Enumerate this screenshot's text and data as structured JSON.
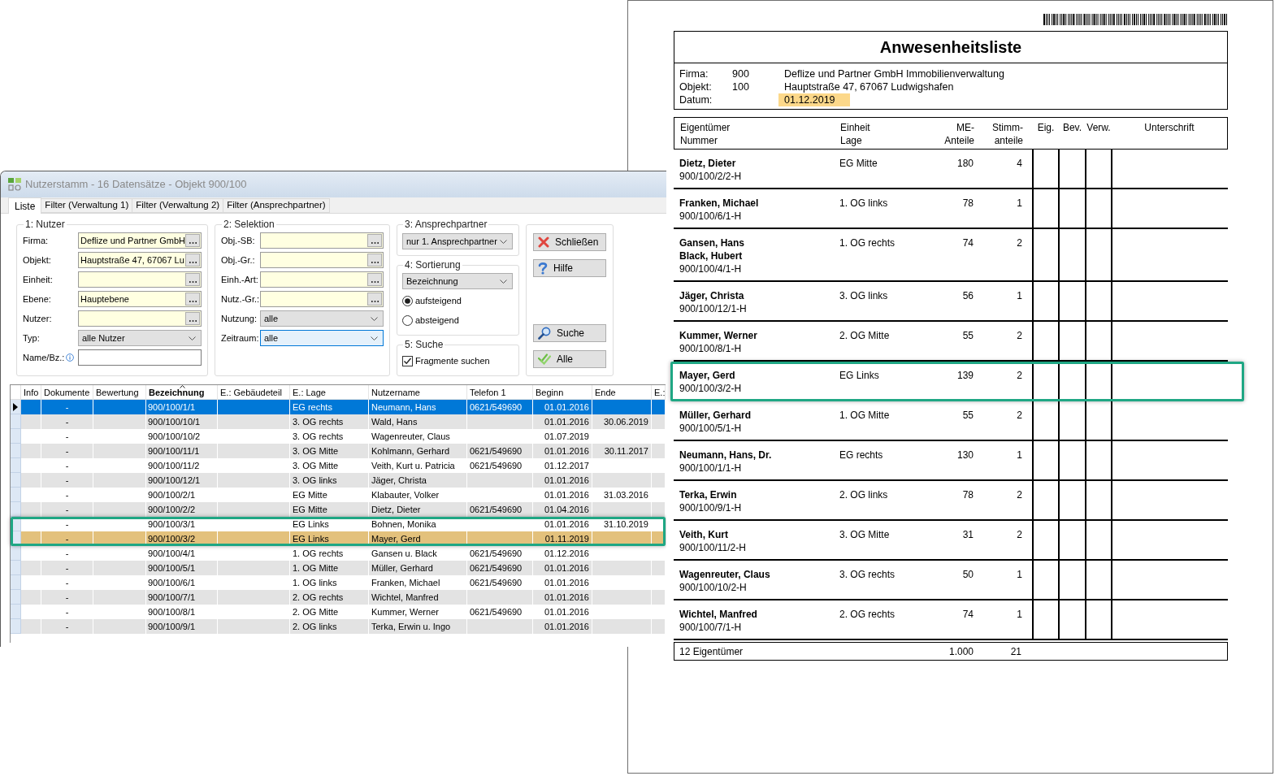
{
  "window": {
    "title": "Nutzerstamm - 16 Datensätze - Objekt 900/100",
    "tabs": [
      {
        "label": "Liste",
        "selected": true
      },
      {
        "label": "Filter (Verwaltung 1)",
        "selected": false
      },
      {
        "label": "Filter (Verwaltung 2)",
        "selected": false
      },
      {
        "label": "Filter (Ansprechpartner)",
        "selected": false
      }
    ],
    "nutzer": {
      "title": "1: Nutzer",
      "fields": [
        {
          "kind": "lookup",
          "label": "Firma:",
          "value": "Deflize und Partner GmbH"
        },
        {
          "kind": "lookup",
          "label": "Objekt:",
          "value": "Hauptstraße 47, 67067 Lu"
        },
        {
          "kind": "lookup",
          "label": "Einheit:"
        },
        {
          "kind": "lookup",
          "label": "Ebene:",
          "value": "Hauptebene"
        },
        {
          "kind": "lookup",
          "label": "Nutzer:"
        },
        {
          "kind": "dropdown",
          "label": "Typ:",
          "value": "alle Nutzer",
          "focused": false
        },
        {
          "kind": "text",
          "label": "Name/Bz.:",
          "info": true
        }
      ]
    },
    "selektion": {
      "title": "2: Selektion",
      "fields": [
        {
          "kind": "lookup",
          "label": "Obj.-SB:"
        },
        {
          "kind": "lookup",
          "label": "Obj.-Gr.:"
        },
        {
          "kind": "lookup",
          "label": "Einh.-Art:"
        },
        {
          "kind": "lookup",
          "label": "Nutz.-Gr.:"
        },
        {
          "kind": "dropdown",
          "label": "Nutzung:",
          "value": "alle",
          "focused": false
        },
        {
          "kind": "dropdown",
          "label": "Zeitraum:",
          "value": "alle",
          "focused": true
        }
      ]
    },
    "ansprechpartner": {
      "title": "3: Ansprechpartner",
      "dropdown": {
        "value": "nur 1. Ansprechpartner",
        "focused": false
      }
    },
    "sortierung": {
      "title": "4: Sortierung",
      "dropdown": {
        "value": "Bezeichnung",
        "focused": false
      },
      "options": [
        {
          "label": "aufsteigend",
          "selected": true
        },
        {
          "label": "absteigend",
          "selected": false
        }
      ]
    },
    "suche": {
      "title": "5: Suche",
      "checkbox": {
        "label": "Fragmente suchen",
        "checked": true
      }
    },
    "buttons": [
      {
        "kind": "close",
        "label": "Schließen"
      },
      {
        "kind": "help",
        "label": "Hilfe"
      },
      {
        "kind": "search",
        "label": "Suche"
      },
      {
        "kind": "all",
        "label": "Alle"
      }
    ],
    "table": {
      "columns": [
        {
          "label": "Info",
          "sorted": false
        },
        {
          "label": "Dokumente",
          "sorted": false
        },
        {
          "label": "Bewertung",
          "sorted": false
        },
        {
          "label": "Bezeichnung",
          "sorted": true
        },
        {
          "label": "E.: Gebäudeteil",
          "sorted": false
        },
        {
          "label": "E.: Lage",
          "sorted": false
        },
        {
          "label": "Nutzername",
          "sorted": false
        },
        {
          "label": "Telefon 1",
          "sorted": false
        },
        {
          "label": "Beginn",
          "sorted": false
        },
        {
          "label": "Ende",
          "sorted": false
        },
        {
          "label": "E.:",
          "sorted": false
        }
      ],
      "rows": [
        {
          "selected": true,
          "highlighted": false,
          "framed": false,
          "dokumente": "-",
          "bezeichnung": "900/100/1/1",
          "lage": "EG rechts",
          "nutzername": "Neumann, Hans",
          "telefon": "0621/549690",
          "beginn": "01.01.2016"
        },
        {
          "selected": false,
          "highlighted": false,
          "framed": false,
          "dokumente": "-",
          "bezeichnung": "900/100/10/1",
          "lage": "3. OG rechts",
          "nutzername": "Wald, Hans",
          "beginn": "01.01.2016",
          "ende": "30.06.2019"
        },
        {
          "selected": false,
          "highlighted": false,
          "framed": false,
          "dokumente": "-",
          "bezeichnung": "900/100/10/2",
          "lage": "3. OG rechts",
          "nutzername": "Wagenreuter, Claus",
          "beginn": "01.07.2019"
        },
        {
          "selected": false,
          "highlighted": false,
          "framed": false,
          "dokumente": "-",
          "bezeichnung": "900/100/11/1",
          "lage": "3. OG Mitte",
          "nutzername": "Kohlmann, Gerhard",
          "telefon": "0621/549690",
          "beginn": "01.01.2016",
          "ende": "30.11.2017"
        },
        {
          "selected": false,
          "highlighted": false,
          "framed": false,
          "dokumente": "-",
          "bezeichnung": "900/100/11/2",
          "lage": "3. OG Mitte",
          "nutzername": "Veith, Kurt u. Patricia",
          "telefon": "0621/549690",
          "beginn": "01.12.2017"
        },
        {
          "selected": false,
          "highlighted": false,
          "framed": false,
          "dokumente": "-",
          "bezeichnung": "900/100/12/1",
          "lage": "3. OG links",
          "nutzername": "Jäger, Christa",
          "beginn": "01.01.2016"
        },
        {
          "selected": false,
          "highlighted": false,
          "framed": false,
          "dokumente": "-",
          "bezeichnung": "900/100/2/1",
          "lage": "EG Mitte",
          "nutzername": "Klabauter, Volker",
          "beginn": "01.01.2016",
          "ende": "31.03.2016"
        },
        {
          "selected": false,
          "highlighted": false,
          "framed": false,
          "dokumente": "-",
          "bezeichnung": "900/100/2/2",
          "lage": "EG Mitte",
          "nutzername": "Dietz, Dieter",
          "telefon": "0621/549690",
          "beginn": "01.04.2016"
        },
        {
          "selected": false,
          "highlighted": false,
          "framed": true,
          "dokumente": "-",
          "bezeichnung": "900/100/3/1",
          "lage": "EG Links",
          "nutzername": "Bohnen, Monika",
          "beginn": "01.01.2016",
          "ende": "31.10.2019"
        },
        {
          "selected": false,
          "highlighted": true,
          "framed": true,
          "dokumente": "-",
          "bezeichnung": "900/100/3/2",
          "lage": "EG Links",
          "nutzername": "Mayer, Gerd",
          "beginn": "01.11.2019"
        },
        {
          "selected": false,
          "highlighted": false,
          "framed": false,
          "dokumente": "-",
          "bezeichnung": "900/100/4/1",
          "lage": "1. OG rechts",
          "nutzername": "Gansen u. Black",
          "telefon": "0621/549690",
          "beginn": "01.12.2016"
        },
        {
          "selected": false,
          "highlighted": false,
          "framed": false,
          "dokumente": "-",
          "bezeichnung": "900/100/5/1",
          "lage": "1. OG Mitte",
          "nutzername": "Müller, Gerhard",
          "telefon": "0621/549690",
          "beginn": "01.01.2016"
        },
        {
          "selected": false,
          "highlighted": false,
          "framed": false,
          "dokumente": "-",
          "bezeichnung": "900/100/6/1",
          "lage": "1. OG links",
          "nutzername": "Franken, Michael",
          "telefon": "0621/549690",
          "beginn": "01.01.2016"
        },
        {
          "selected": false,
          "highlighted": false,
          "framed": false,
          "dokumente": "-",
          "bezeichnung": "900/100/7/1",
          "lage": "2. OG rechts",
          "nutzername": "Wichtel, Manfred",
          "beginn": "01.01.2016"
        },
        {
          "selected": false,
          "highlighted": false,
          "framed": false,
          "dokumente": "-",
          "bezeichnung": "900/100/8/1",
          "lage": "2. OG Mitte",
          "nutzername": "Kummer, Werner",
          "telefon": "0621/549690",
          "beginn": "01.01.2016"
        },
        {
          "selected": false,
          "highlighted": false,
          "framed": false,
          "dokumente": "-",
          "bezeichnung": "900/100/9/1",
          "lage": "2. OG links",
          "nutzername": "Terka, Erwin u. Ingo",
          "beginn": "01.01.2016"
        }
      ]
    }
  },
  "report": {
    "title": "Anwesenheitsliste",
    "info": [
      {
        "label": "Firma:",
        "number": "900",
        "value": "Deflize und Partner GmbH Immobilienverwaltung",
        "highlighted": false
      },
      {
        "label": "Objekt:",
        "number": "100",
        "value": "Hauptstraße 47, 67067 Ludwigshafen",
        "highlighted": false
      },
      {
        "label": "Datum:",
        "value": "01.12.2019",
        "highlighted": true
      }
    ],
    "columns": [
      {
        "lines": [
          "Eigentümer",
          "Nummer"
        ]
      },
      {
        "lines": [
          "Einheit",
          "Lage"
        ]
      },
      {
        "lines": [
          "ME-",
          "Anteile"
        ]
      },
      {
        "lines": [
          "Stimm-",
          "anteile"
        ]
      },
      {
        "lines": [
          "Eig."
        ]
      },
      {
        "lines": [
          "Bev."
        ]
      },
      {
        "lines": [
          "Verw."
        ]
      },
      {
        "lines": [
          "Unterschrift"
        ]
      }
    ],
    "rows": [
      {
        "owners": [
          "Dietz, Dieter"
        ],
        "number": "900/100/2/2-H",
        "lage": "EG Mitte",
        "me_anteile": "180",
        "stimmanteile": "4",
        "framed": false
      },
      {
        "owners": [
          "Franken, Michael"
        ],
        "number": "900/100/6/1-H",
        "lage": "1. OG links",
        "me_anteile": "78",
        "stimmanteile": "1",
        "framed": false
      },
      {
        "owners": [
          "Gansen, Hans",
          "Black, Hubert"
        ],
        "number": "900/100/4/1-H",
        "lage": "1. OG rechts",
        "me_anteile": "74",
        "stimmanteile": "2",
        "framed": false
      },
      {
        "owners": [
          "Jäger, Christa"
        ],
        "number": "900/100/12/1-H",
        "lage": "3. OG links",
        "me_anteile": "56",
        "stimmanteile": "1",
        "framed": false
      },
      {
        "owners": [
          "Kummer, Werner"
        ],
        "number": "900/100/8/1-H",
        "lage": "2. OG Mitte",
        "me_anteile": "55",
        "stimmanteile": "2",
        "framed": false
      },
      {
        "owners": [
          "Mayer, Gerd"
        ],
        "number": "900/100/3/2-H",
        "lage": "EG Links",
        "me_anteile": "139",
        "stimmanteile": "2",
        "framed": true
      },
      {
        "owners": [
          "Müller, Gerhard"
        ],
        "number": "900/100/5/1-H",
        "lage": "1. OG Mitte",
        "me_anteile": "55",
        "stimmanteile": "2",
        "framed": false
      },
      {
        "owners": [
          "Neumann, Hans, Dr."
        ],
        "number": "900/100/1/1-H",
        "lage": "EG rechts",
        "me_anteile": "130",
        "stimmanteile": "1",
        "framed": false
      },
      {
        "owners": [
          "Terka, Erwin"
        ],
        "number": "900/100/9/1-H",
        "lage": "2. OG links",
        "me_anteile": "78",
        "stimmanteile": "2",
        "framed": false
      },
      {
        "owners": [
          "Veith, Kurt"
        ],
        "number": "900/100/11/2-H",
        "lage": "3. OG Mitte",
        "me_anteile": "31",
        "stimmanteile": "2",
        "framed": false
      },
      {
        "owners": [
          "Wagenreuter, Claus"
        ],
        "number": "900/100/10/2-H",
        "lage": "3. OG rechts",
        "me_anteile": "50",
        "stimmanteile": "1",
        "framed": false
      },
      {
        "owners": [
          "Wichtel, Manfred"
        ],
        "number": "900/100/7/1-H",
        "lage": "2. OG rechts",
        "me_anteile": "74",
        "stimmanteile": "1",
        "framed": false
      }
    ],
    "footer": {
      "label": "12 Eigentümer",
      "me_anteile": "1.000",
      "stimmanteile": "21"
    }
  }
}
